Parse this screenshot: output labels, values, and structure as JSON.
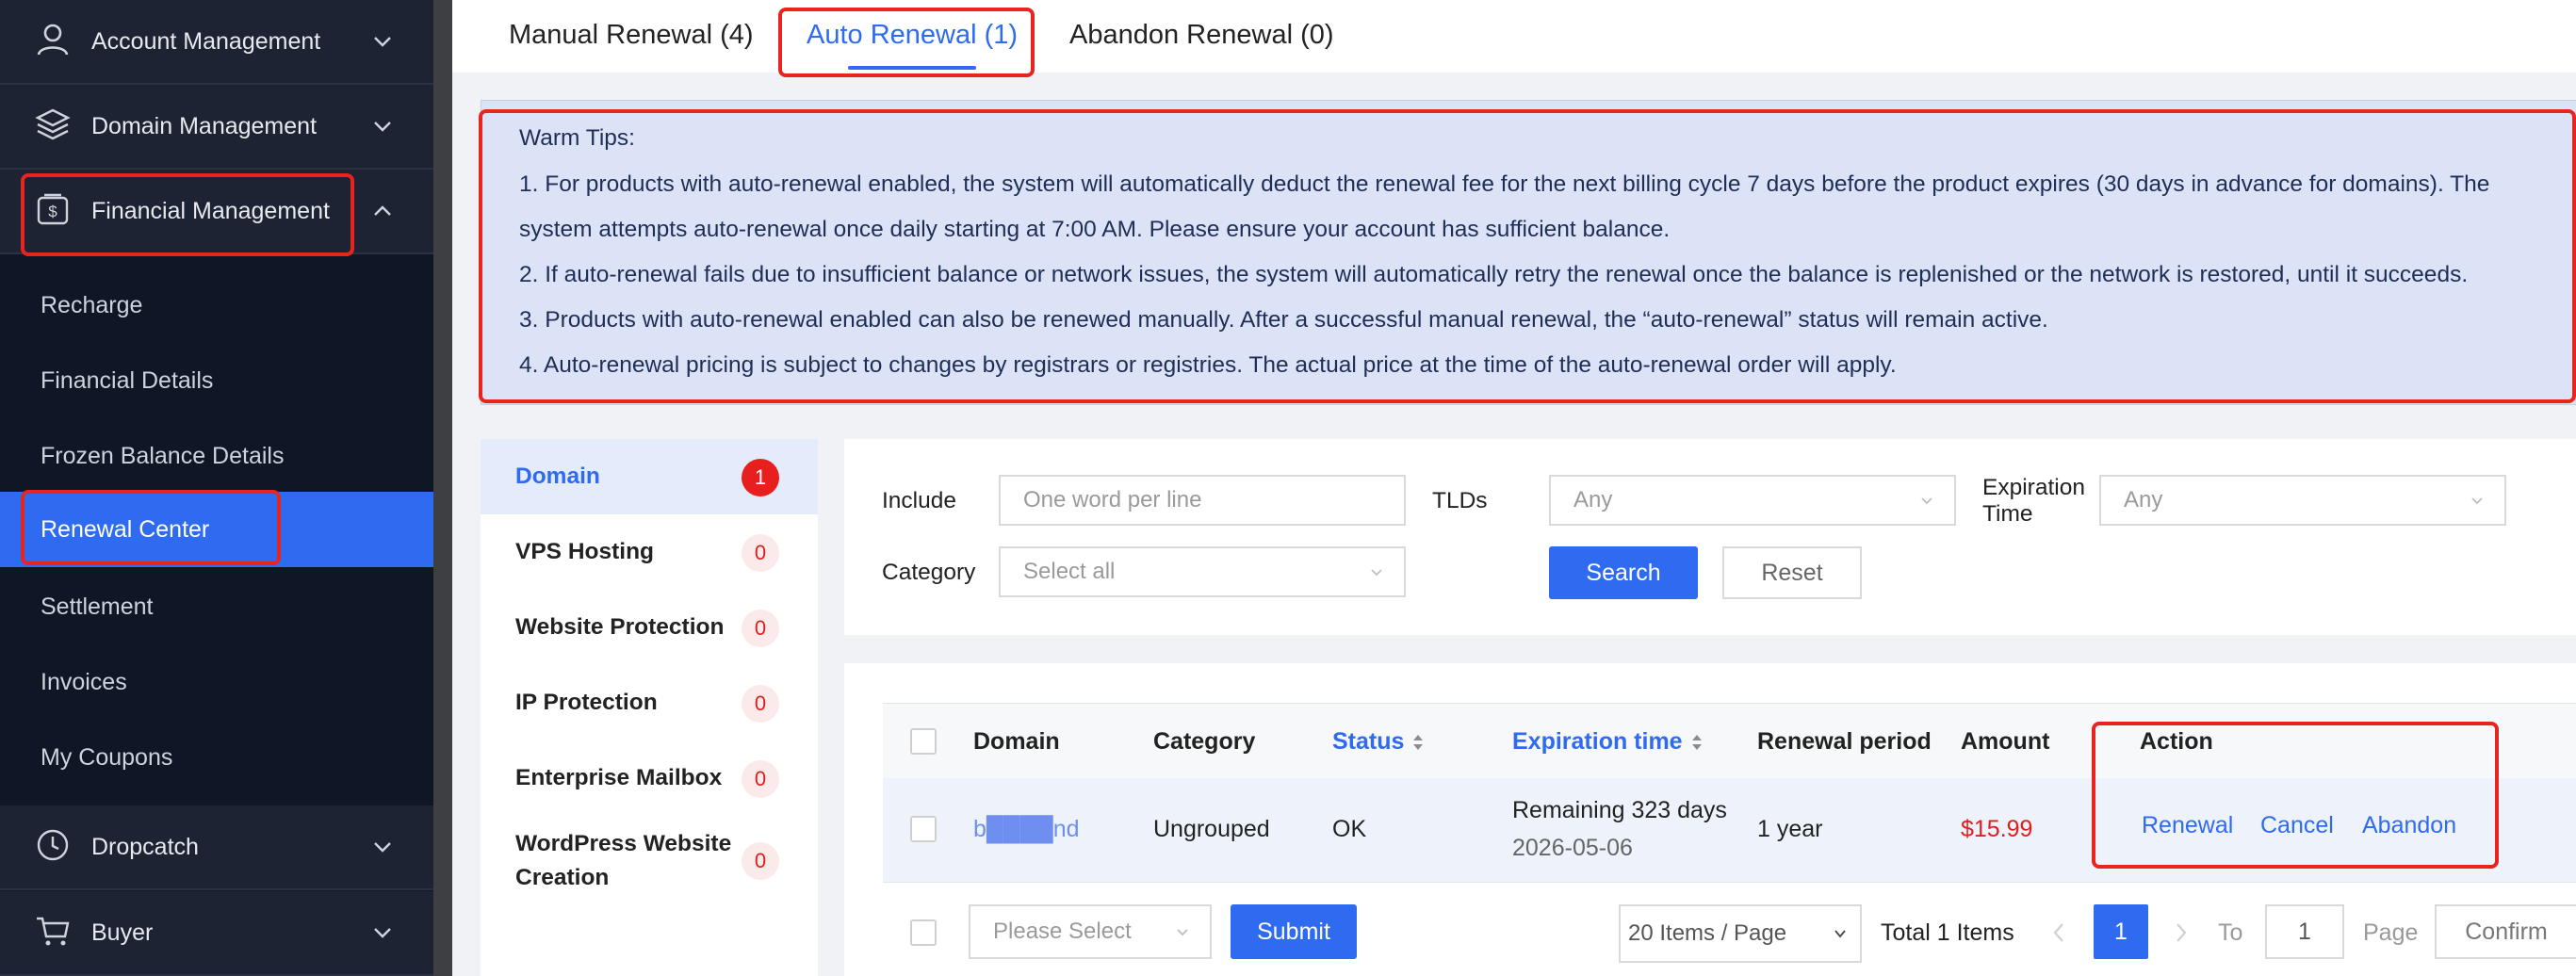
{
  "sidebar": {
    "groups": [
      {
        "label": "Account Management",
        "icon": "user-icon"
      },
      {
        "label": "Domain Management",
        "icon": "layers-icon"
      },
      {
        "label": "Financial Management",
        "icon": "dollar-icon"
      },
      {
        "label": "Dropcatch",
        "icon": "clock-icon"
      },
      {
        "label": "Buyer",
        "icon": "cart-icon"
      }
    ],
    "financial_items": [
      {
        "label": "Recharge"
      },
      {
        "label": "Financial Details"
      },
      {
        "label": "Frozen Balance Details"
      },
      {
        "label": "Renewal Center",
        "active": true
      },
      {
        "label": "Settlement"
      },
      {
        "label": "Invoices"
      },
      {
        "label": "My Coupons"
      }
    ]
  },
  "tabs": [
    {
      "label": "Manual Renewal (4)"
    },
    {
      "label": "Auto Renewal (1)",
      "active": true
    },
    {
      "label": "Abandon Renewal (0)"
    }
  ],
  "tips": {
    "title": "Warm Tips:",
    "lines": [
      "1. For products with auto-renewal enabled, the system will automatically deduct the renewal fee for the next billing cycle 7 days before the product expires (30 days in advance for domains). The",
      "system attempts auto-renewal once daily starting at 7:00 AM. Please ensure your account has sufficient balance.",
      "2. If auto-renewal fails due to insufficient balance or network issues, the system will automatically retry the renewal once the balance is replenished or the network is restored, until it succeeds.",
      "3. Products with auto-renewal enabled can also be renewed manually. After a successful manual renewal, the “auto-renewal” status will remain active.",
      "4. Auto-renewal pricing is subject to changes by registrars or registries. The actual price at the time of the auto-renewal order will apply."
    ]
  },
  "categories": [
    {
      "label": "Domain",
      "count": "1",
      "active": true
    },
    {
      "label": "VPS Hosting",
      "count": "0"
    },
    {
      "label": "Website Protection",
      "count": "0"
    },
    {
      "label": "IP Protection",
      "count": "0"
    },
    {
      "label": "Enterprise Mailbox",
      "count": "0"
    },
    {
      "label": "WordPress Website Creation",
      "count": "0"
    }
  ],
  "filter": {
    "include_label": "Include",
    "include_placeholder": "One word per line",
    "tlds_label": "TLDs",
    "tlds_value": "Any",
    "expiration_label": "Expiration Time",
    "expiration_value": "Any",
    "category_label": "Category",
    "category_value": "Select all",
    "search_button": "Search",
    "reset_button": "Reset"
  },
  "table": {
    "headers": {
      "domain": "Domain",
      "category": "Category",
      "status": "Status",
      "expiration": "Expiration time",
      "period": "Renewal period",
      "amount": "Amount",
      "action": "Action"
    },
    "rows": [
      {
        "domain": "b████nd",
        "category": "Ungrouped",
        "status": "OK",
        "remaining": "Remaining 323 days",
        "expiry_date": "2026-05-06",
        "period": "1 year",
        "amount": "$15.99",
        "actions": [
          "Renewal",
          "Cancel",
          "Abandon"
        ]
      }
    ]
  },
  "footer": {
    "bulk_select_placeholder": "Please Select",
    "submit_button": "Submit",
    "page_size": "20 Items / Page",
    "total": "Total 1 Items",
    "current_page": "1",
    "goto_label": "To",
    "goto_value": "1",
    "page_label": "Page",
    "confirm_button": "Confirm"
  },
  "colors": {
    "sidebar_bg": "#0f1626",
    "accent": "#2f6bf1",
    "highlight_box": "#e8241f",
    "amount": "#e01e1e"
  }
}
